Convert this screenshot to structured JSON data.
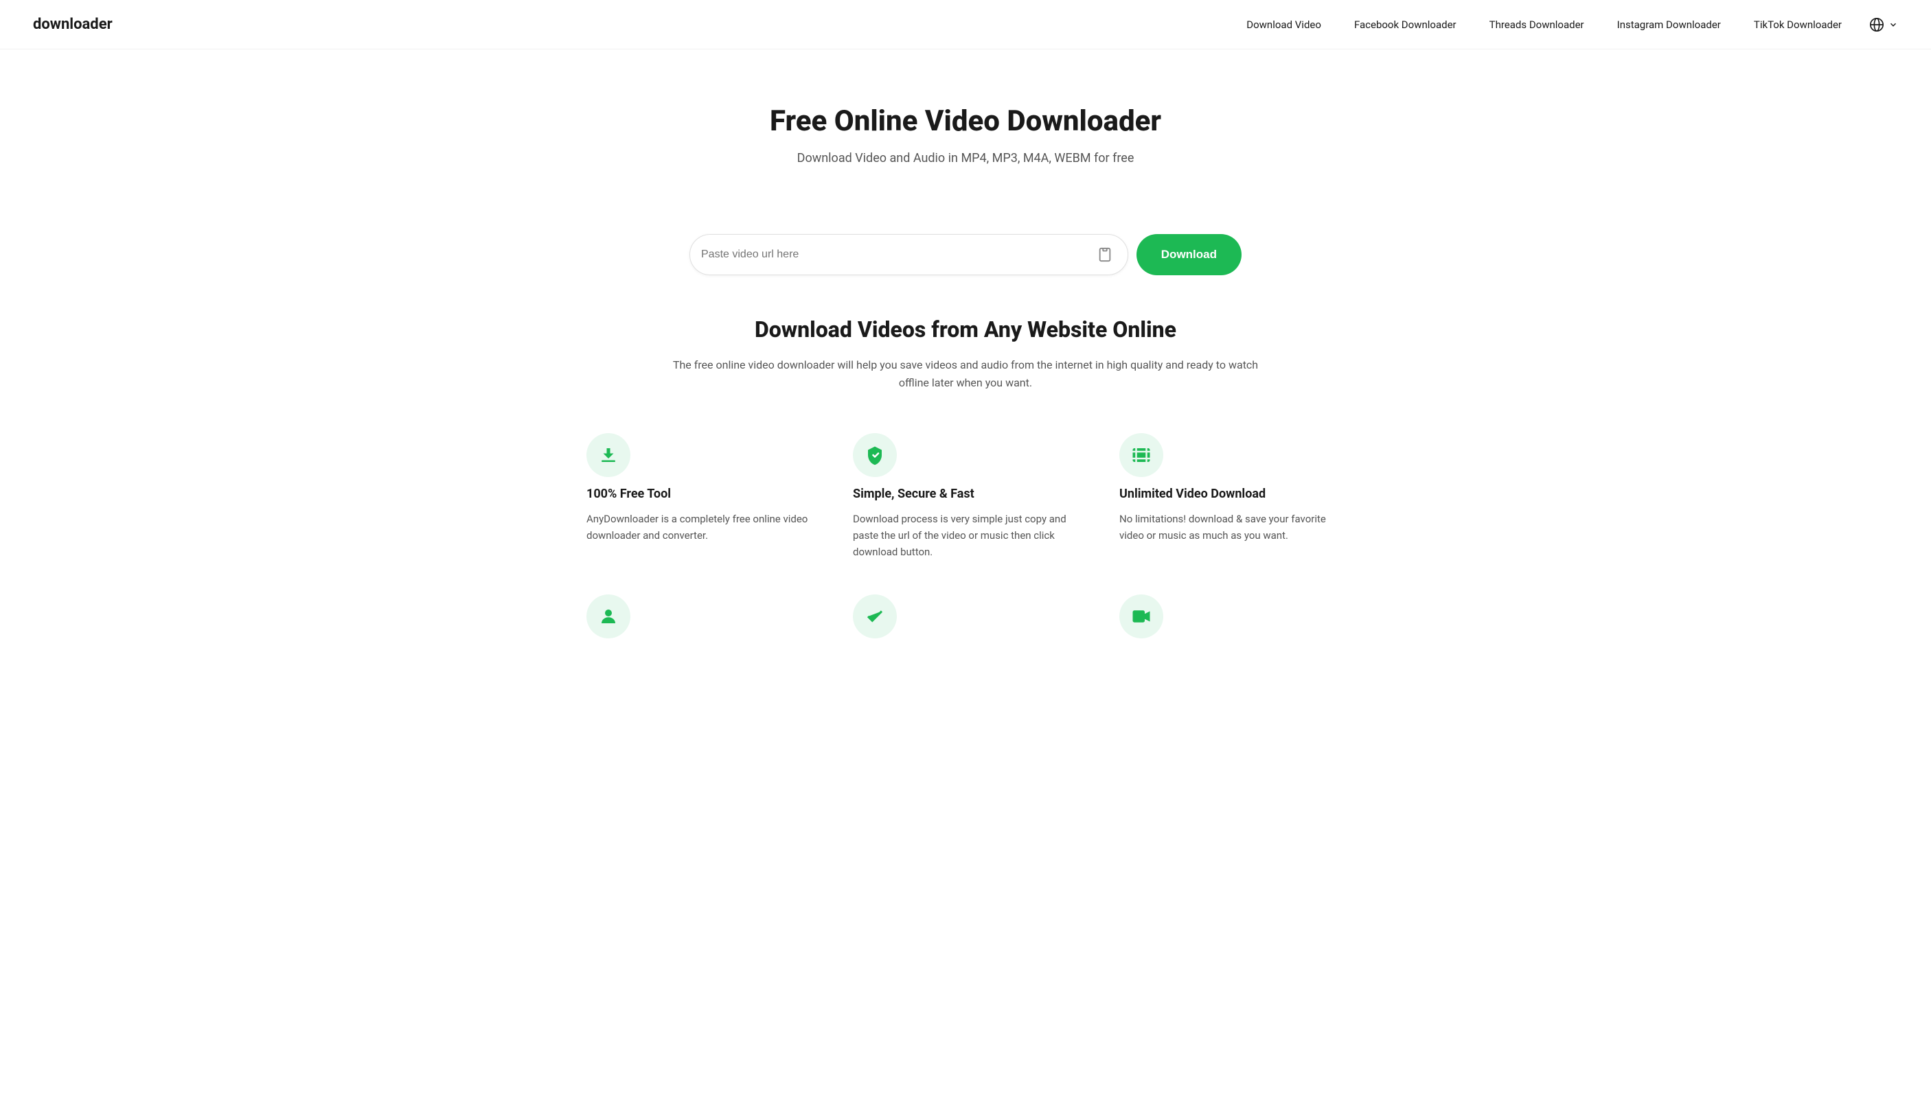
{
  "brand": {
    "name": "downloader"
  },
  "navbar": {
    "links": [
      {
        "label": "Download Video",
        "href": "#"
      },
      {
        "label": "Facebook Downloader",
        "href": "#"
      },
      {
        "label": "Threads Downloader",
        "href": "#"
      },
      {
        "label": "Instagram Downloader",
        "href": "#"
      },
      {
        "label": "TikTok Downloader",
        "href": "#"
      }
    ],
    "lang_label": "Language"
  },
  "hero": {
    "title": "Free Online Video Downloader",
    "subtitle": "Download Video and Audio in MP4, MP3, M4A, WEBM for free"
  },
  "search": {
    "placeholder": "Paste video url here",
    "download_button": "Download"
  },
  "features_section": {
    "title": "Download Videos from Any Website Online",
    "description": "The free online video downloader will help you save videos and audio from the internet in high quality and ready to watch offline later when you want.",
    "features": [
      {
        "id": "free-tool",
        "icon": "download-icon",
        "title": "100% Free Tool",
        "description": "AnyDownloader is a completely free online video downloader and converter."
      },
      {
        "id": "simple-secure",
        "icon": "shield-icon",
        "title": "Simple, Secure & Fast",
        "description": "Download process is very simple just copy and paste the url of the video or music then click download button."
      },
      {
        "id": "unlimited",
        "icon": "film-icon",
        "title": "Unlimited Video Download",
        "description": "No limitations! download & save your favorite video or music as much as you want."
      }
    ],
    "bottom_features": [
      {
        "id": "user-feature",
        "icon": "user-icon"
      },
      {
        "id": "check-feature",
        "icon": "check-icon"
      },
      {
        "id": "video-feature",
        "icon": "video-icon"
      }
    ]
  }
}
